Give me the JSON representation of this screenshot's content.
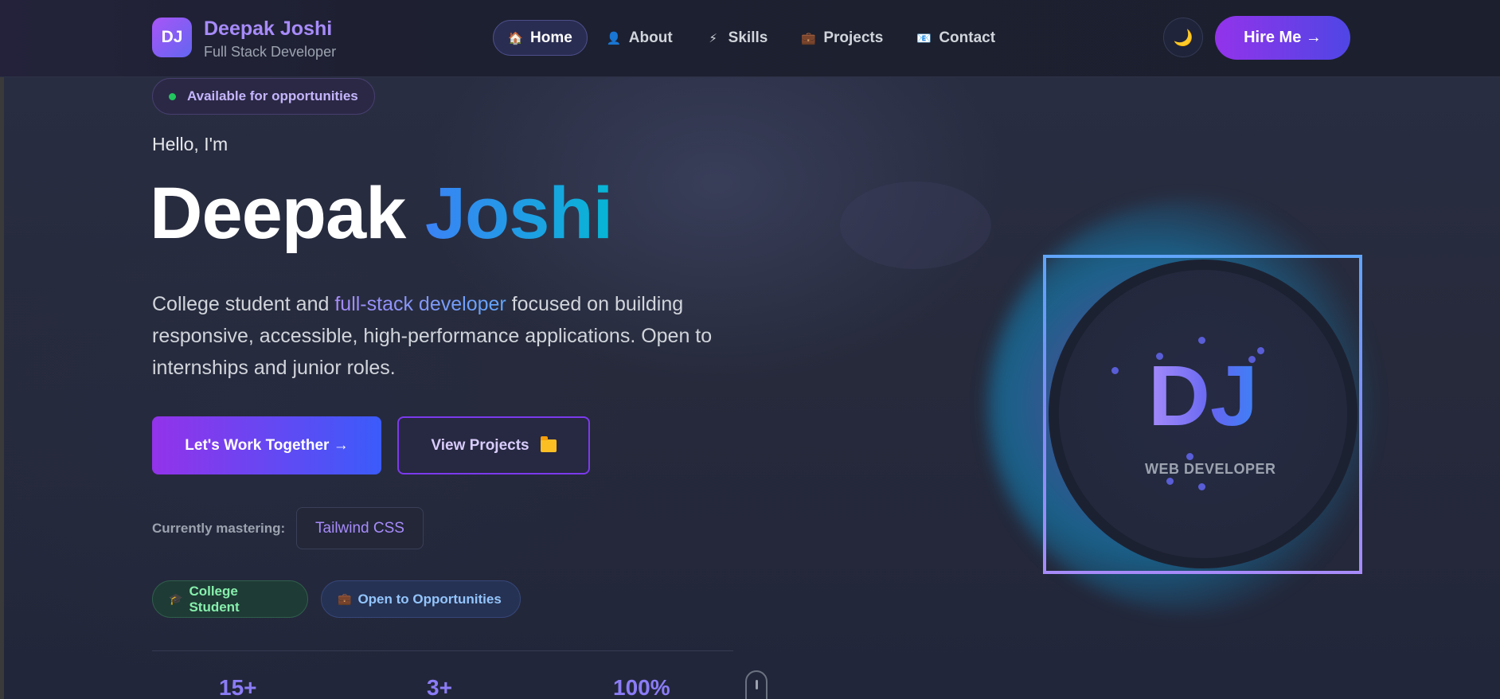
{
  "nav": {
    "logo": "DJ",
    "brand_name": "Deepak Joshi",
    "brand_subtitle": "Full Stack Developer",
    "items": [
      {
        "label": "Home",
        "icon": "🏠",
        "active": true
      },
      {
        "label": "About",
        "icon": "👤",
        "active": false
      },
      {
        "label": "Skills",
        "icon": "⚡",
        "active": false
      },
      {
        "label": "Projects",
        "icon": "💼",
        "active": false
      },
      {
        "label": "Contact",
        "icon": "📧",
        "active": false
      }
    ],
    "theme_icon": "🌙",
    "hire_label": "Hire Me →"
  },
  "hero": {
    "availability": "Available for opportunities",
    "greeting": "Hello, I'm",
    "first_name": "Deepak",
    "last_name": "Joshi",
    "desc_before": "College student and ",
    "desc_highlight": "full-stack developer",
    "desc_after": " focused on building responsive, accessible, high-performance applications. Open to internships and junior roles.",
    "primary_cta": "Let's Work Together →",
    "secondary_cta": "View Projects",
    "mastering_label": "Currently mastering:",
    "mastering_value": "Tailwind CSS",
    "badges": [
      {
        "icon": "🎓",
        "label": "College Student"
      },
      {
        "icon": "💼",
        "label": "Open to Opportunities"
      }
    ],
    "stats": [
      "15+",
      "3+",
      "100%"
    ]
  },
  "portrait": {
    "initials": "DJ",
    "caption": "WEB DEVELOPER"
  },
  "colors": {
    "accent_purple": "#9333ea",
    "accent_blue": "#3b82f6",
    "accent_cyan": "#06b6d4",
    "background": "#262a3d"
  }
}
